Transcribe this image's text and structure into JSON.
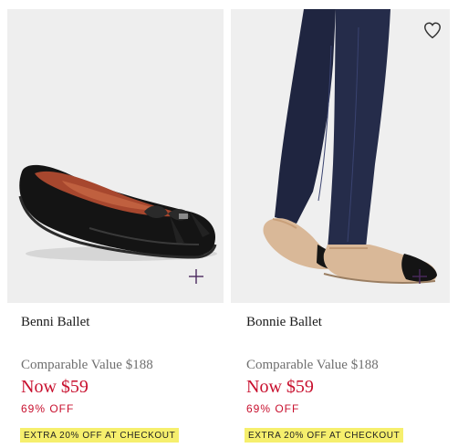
{
  "products": [
    {
      "name": "Benni Ballet",
      "comparable": "Comparable Value $188",
      "now": "Now $59",
      "discount": "69% OFF",
      "promo": "EXTRA 20% OFF AT CHECKOUT",
      "image_icon": "plus-icon"
    },
    {
      "name": "Bonnie Ballet",
      "comparable": "Comparable Value $188",
      "now": "Now $59",
      "discount": "69% OFF",
      "promo": "EXTRA 20% OFF AT CHECKOUT",
      "image_icon": "plus-icon",
      "wishlist_icon": "heart-icon"
    }
  ],
  "colors": {
    "sale": "#c8102e",
    "promo_bg": "#f6ef6d",
    "image_bg": "#eeeeee"
  }
}
